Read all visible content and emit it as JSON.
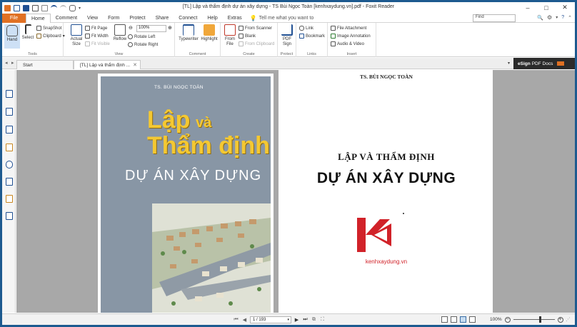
{
  "window": {
    "title": "[TL] Lập và thẩm định dự án xây dựng - TS Bùi Ngọc Toàn [kenhxaydung.vn].pdf - Foxit Reader"
  },
  "menu": {
    "file": "File",
    "items": [
      "Home",
      "Comment",
      "View",
      "Form",
      "Protect",
      "Share",
      "Connect",
      "Help",
      "Extras"
    ],
    "tell_me": "Tell me what you want to",
    "find_placeholder": "Find"
  },
  "ribbon": {
    "tools": {
      "label": "Tools",
      "hand": "Hand",
      "select": "Select",
      "snapshot": "SnapShot",
      "clipboard": "Clipboard"
    },
    "view": {
      "label": "View",
      "actual_size": "Actual Size",
      "fit_page": "Fit Page",
      "fit_width": "Fit Width",
      "fit_visible": "Fit Visible",
      "reflow": "Reflow",
      "zoom_value": "100%",
      "rotate_left": "Rotate Left",
      "rotate_right": "Rotate Right"
    },
    "comment": {
      "label": "Comment",
      "typewriter": "Typewriter",
      "highlight": "Highlight"
    },
    "create": {
      "label": "Create",
      "from_file": "From File",
      "from_scanner": "From Scanner",
      "blank": "Blank",
      "from_clipboard": "From Clipboard"
    },
    "protect": {
      "label": "Protect",
      "pdf_sign": "PDF Sign"
    },
    "links": {
      "label": "Links",
      "link": "Link",
      "bookmark": "Bookmark"
    },
    "insert": {
      "label": "Insert",
      "file_attachment": "File Attachment",
      "image_annotation": "Image Annotation",
      "audio_video": "Audio & Video"
    }
  },
  "tabs": {
    "start": "Start",
    "document": "[TL] Lập và thẩm định ...",
    "esign_bold": "eSign",
    "esign_rest": "PDF Docs"
  },
  "document": {
    "cover_author": "TS. BÙI NGỌC TOÀN",
    "cover_title_1": "Lập",
    "cover_title_1b": "và",
    "cover_title_2": "Thẩm định",
    "cover_title_3": "DỰ ÁN XÂY DỰNG",
    "page2_author": "TS. BÙI NGỌC TOÀN",
    "page2_title_1": "LẬP VÀ THẨM ĐỊNH",
    "page2_title_2": "DỰ ÁN XÂY DỰNG",
    "page2_site": "kenhxaydung.vn"
  },
  "statusbar": {
    "page_value": "1 / 193",
    "zoom": "100%"
  },
  "colors": {
    "accent": "#e07023",
    "brand_red": "#d12229",
    "icon_blue": "#1f4f92",
    "cover_yellow": "#f4c832"
  }
}
